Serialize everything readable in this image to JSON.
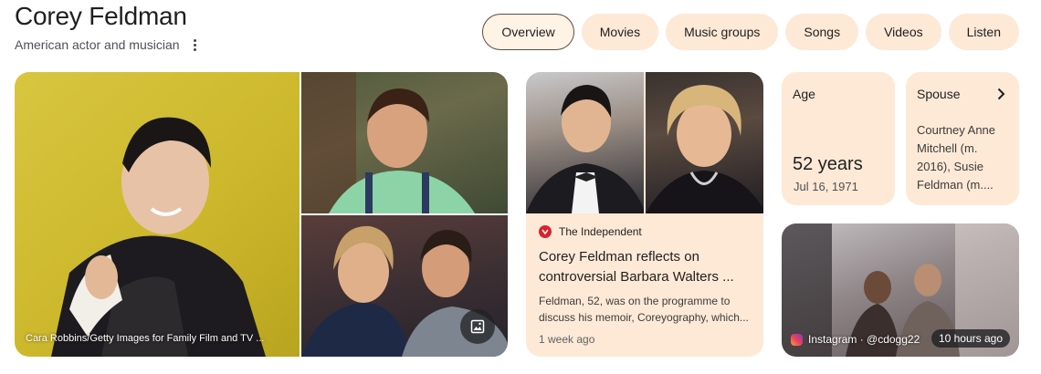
{
  "entity": {
    "name": "Corey Feldman",
    "description": "American actor and musician"
  },
  "tabs": [
    {
      "label": "Overview",
      "active": true
    },
    {
      "label": "Movies"
    },
    {
      "label": "Music groups"
    },
    {
      "label": "Songs"
    },
    {
      "label": "Videos"
    },
    {
      "label": "Listen"
    }
  ],
  "photos": {
    "main_credit": "Cara Robbins/Getty Images for Family Film and TV ..."
  },
  "news": {
    "source": "The Independent",
    "headline": "Corey Feldman reflects on controversial Barbara Walters ...",
    "snippet": "Feldman, 52, was on the programme to discuss his memoir, Coreyography, which...",
    "time": "1 week ago"
  },
  "facts": {
    "age": {
      "label": "Age",
      "value": "52 years",
      "sub": "Jul 16, 1971"
    },
    "spouse": {
      "label": "Spouse",
      "value": "Courtney Anne Mitchell (m. 2016), Susie Feldman (m...."
    }
  },
  "social": {
    "source": "Instagram · @cdogg22",
    "time": "10 hours ago"
  },
  "colors": {
    "chip_bg": "#fde9d6",
    "active_chip_border": "#5f4b3d",
    "card_bg": "#fde9d6"
  }
}
